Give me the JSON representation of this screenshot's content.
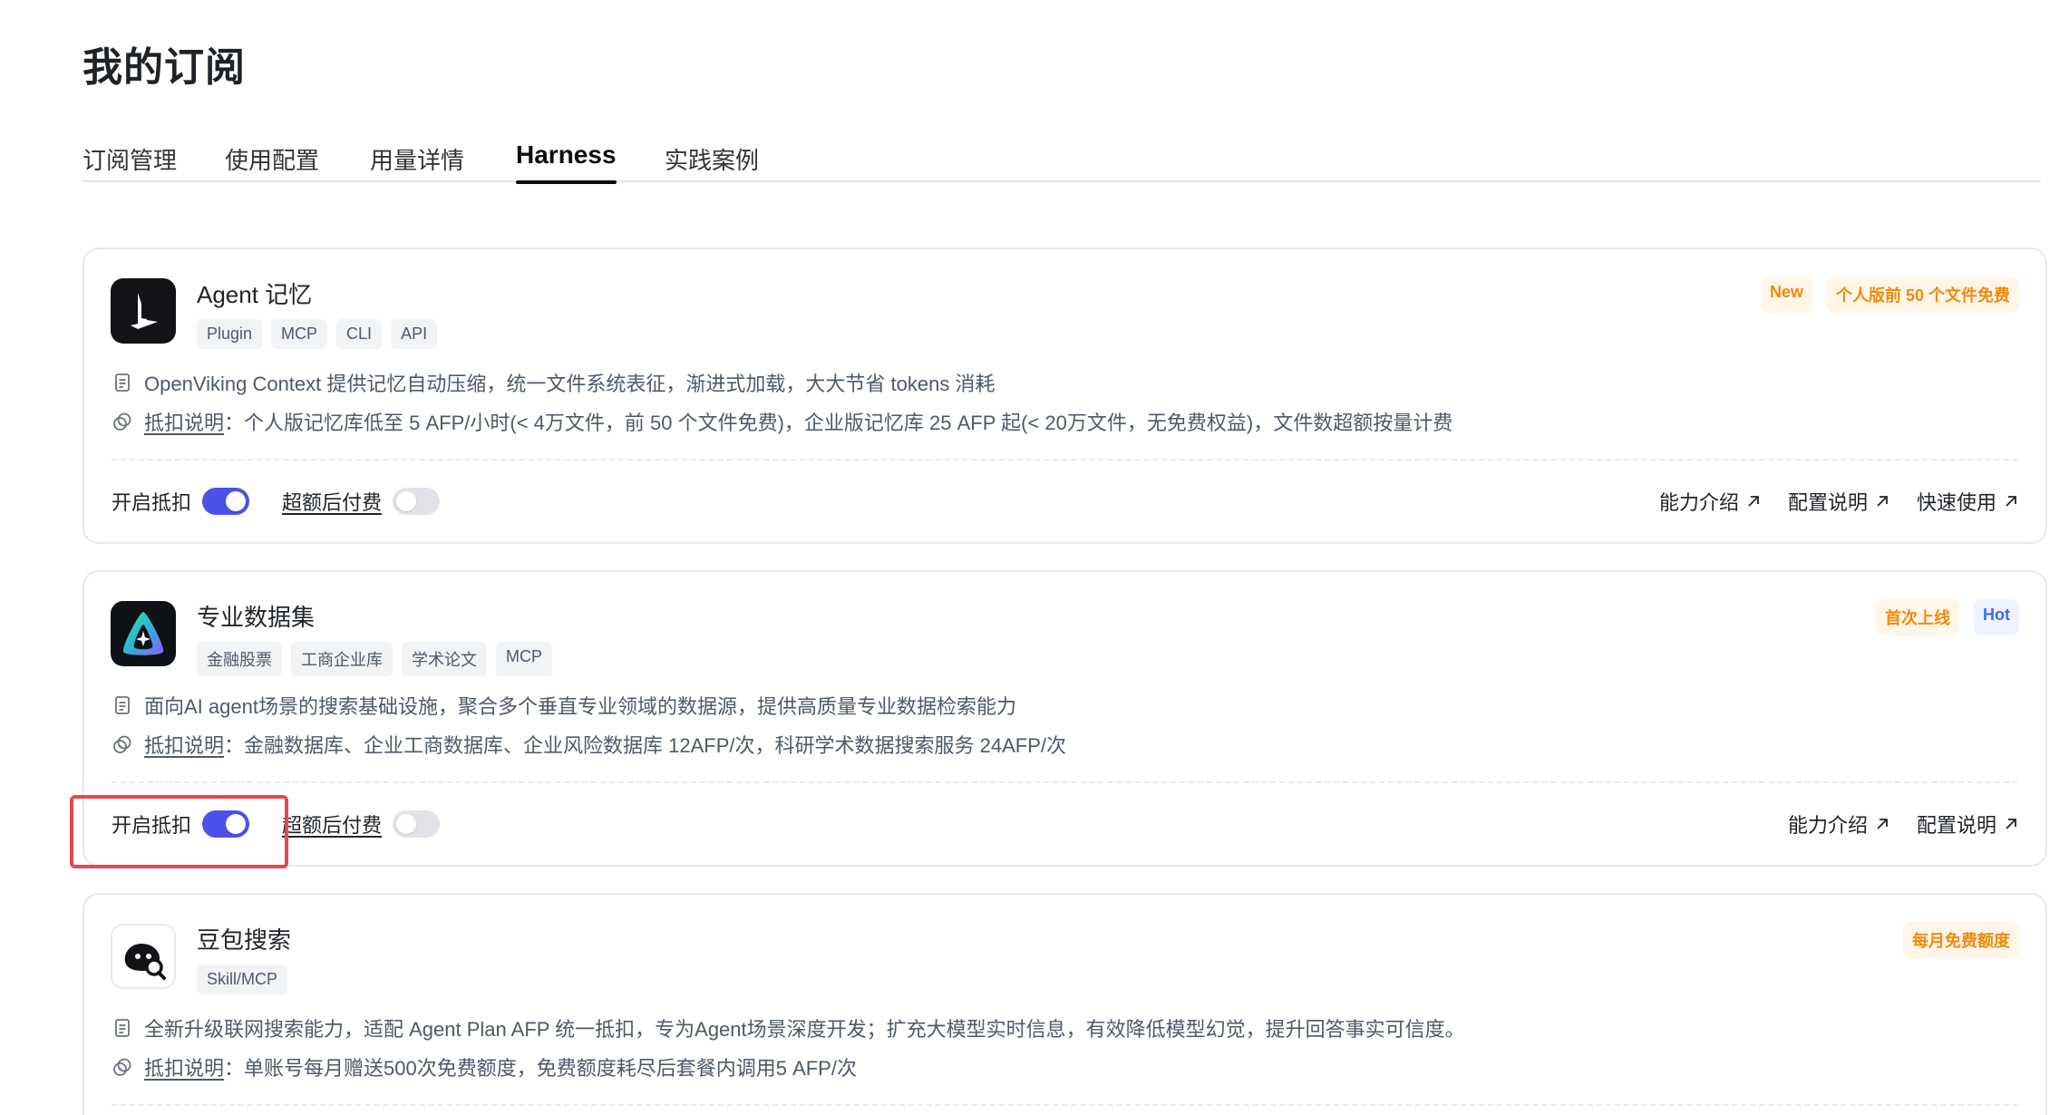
{
  "page": {
    "title": "我的订阅"
  },
  "tabs": [
    {
      "label": "订阅管理",
      "active": false
    },
    {
      "label": "使用配置",
      "active": false
    },
    {
      "label": "用量详情",
      "active": false
    },
    {
      "label": "Harness",
      "active": true
    },
    {
      "label": "实践案例",
      "active": false
    }
  ],
  "cards": [
    {
      "name": "Agent 记忆",
      "tags": [
        "Plugin",
        "MCP",
        "CLI",
        "API"
      ],
      "badges": [
        {
          "text": "New",
          "color": "#f08a0c"
        },
        {
          "text": "个人版前 50 个文件免费",
          "color": "#f08a0c"
        }
      ],
      "description": "OpenViking Context 提供记忆自动压缩，统一文件系统表征，渐进式加载，大大节省 tokens 消耗",
      "billing_link": "抵扣说明",
      "billing_text": "：个人版记忆库低至 5 AFP/小时(< 4万文件，前 50 个文件免费)，企业版记忆库 25 AFP 起(< 20万文件，无免费权益)，文件数超额按量计费",
      "toggle1_label": "开启抵扣",
      "toggle1_on": true,
      "toggle2_label": "超额后付费",
      "toggle2_on": false,
      "links": [
        "能力介绍",
        "配置说明",
        "快速使用"
      ]
    },
    {
      "name": "专业数据集",
      "tags": [
        "金融股票",
        "工商企业库",
        "学术论文",
        "MCP"
      ],
      "badges": [
        {
          "text": "首次上线",
          "color": "#f08a0c"
        },
        {
          "text": "Hot",
          "color": "#3c6cf0"
        }
      ],
      "description": "面向AI agent场景的搜索基础设施，聚合多个垂直专业领域的数据源，提供高质量专业数据检索能力",
      "billing_link": "抵扣说明",
      "billing_text": "：金融数据库、企业工商数据库、企业风险数据库 12AFP/次，科研学术数据搜索服务 24AFP/次",
      "toggle1_label": "开启抵扣",
      "toggle1_on": true,
      "toggle2_label": "超额后付费",
      "toggle2_on": false,
      "links": [
        "能力介绍",
        "配置说明"
      ]
    },
    {
      "name": "豆包搜索",
      "tags": [
        "Skill/MCP"
      ],
      "badges": [
        {
          "text": "每月免费额度",
          "color": "#f08a0c"
        }
      ],
      "description": "全新升级联网搜索能力，适配 Agent Plan AFP 统一抵扣，专为Agent场景深度开发；扩充大模型实时信息，有效降低模型幻觉，提升回答事实可信度。",
      "billing_link": "抵扣说明",
      "billing_text": "：单账号每月赠送500次免费额度，免费额度耗尽后套餐内调用5 AFP/次"
    }
  ],
  "colors": {
    "accent": "#4d51e9",
    "highlight": "#e5484d",
    "badge_orange": "#f08a0c",
    "badge_blue": "#3c6cf0"
  }
}
